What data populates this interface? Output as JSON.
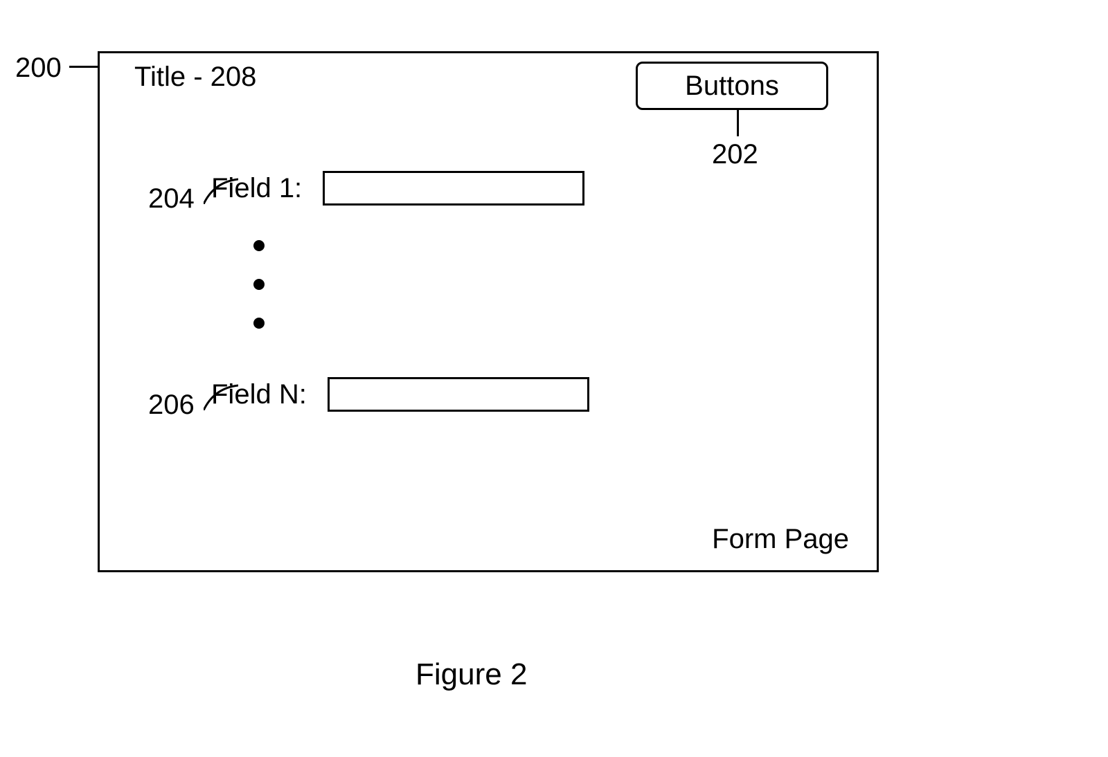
{
  "refs": {
    "r200": "200",
    "r202": "202",
    "r204": "204",
    "r206": "206"
  },
  "title": "Title - 208",
  "buttons_label": "Buttons",
  "fields": {
    "field_1_label": "Field 1:",
    "field_n_label": "Field N:"
  },
  "form_page_label": "Form Page",
  "figure_caption": "Figure 2"
}
